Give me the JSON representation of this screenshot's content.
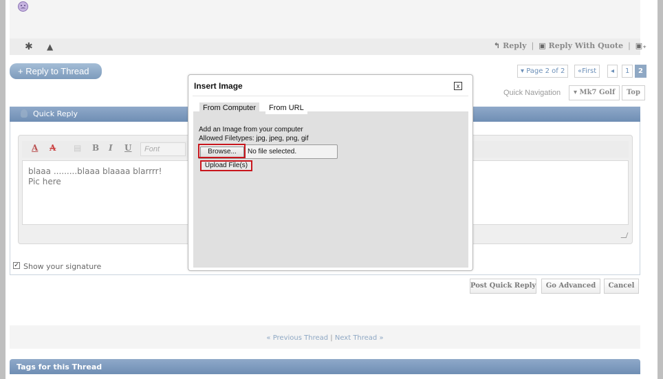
{
  "post": {
    "smiley_icon": "frown-smiley-icon",
    "foot_icons": [
      "star-icon",
      "warning-icon"
    ],
    "actions": {
      "reply": "Reply",
      "reply_with_quote": "Reply With Quote",
      "multiquote_icon": "multiquote-plus-icon"
    }
  },
  "thread": {
    "reply_to_thread": "+ Reply to Thread",
    "pagination": {
      "page_label": "▾ Page 2 of 2",
      "first": "«First",
      "prev": "◂",
      "pages": [
        "1",
        "2"
      ],
      "current_page": "2"
    },
    "quick_navigation": {
      "label": "Quick Navigation",
      "forum": "▾ Mk7 Golf",
      "top": "Top"
    }
  },
  "quick_reply": {
    "title": "Quick Reply",
    "toolbar": {
      "font_color": "A",
      "remove_format": "A",
      "paste": "▤",
      "bold": "B",
      "italic": "I",
      "underline": "U",
      "font_placeholder": "Font"
    },
    "message_lines": [
      "blaaa .........blaaa blaaaa blarrrr!",
      "Pic here"
    ],
    "show_signature": "Show your signature",
    "signature_checked": true,
    "buttons": {
      "post_quick_reply": "Post Quick Reply",
      "go_advanced": "Go Advanced",
      "cancel": "Cancel"
    }
  },
  "thread_nav": {
    "previous": "« Previous Thread",
    "separator": "|",
    "next": "Next Thread »"
  },
  "tags": {
    "title": "Tags for this Thread"
  },
  "dialog": {
    "title": "Insert Image",
    "close": "x",
    "tabs": [
      "From Computer",
      "From URL"
    ],
    "active_tab": "From Computer",
    "add_text": "Add an Image from your computer",
    "allowed_text": "Allowed Filetypes: jpg, jpeg, png, gif",
    "browse": "Browse...",
    "no_file": "No file selected.",
    "upload": "Upload File(s)",
    "highlight_color": "#c8161d"
  }
}
